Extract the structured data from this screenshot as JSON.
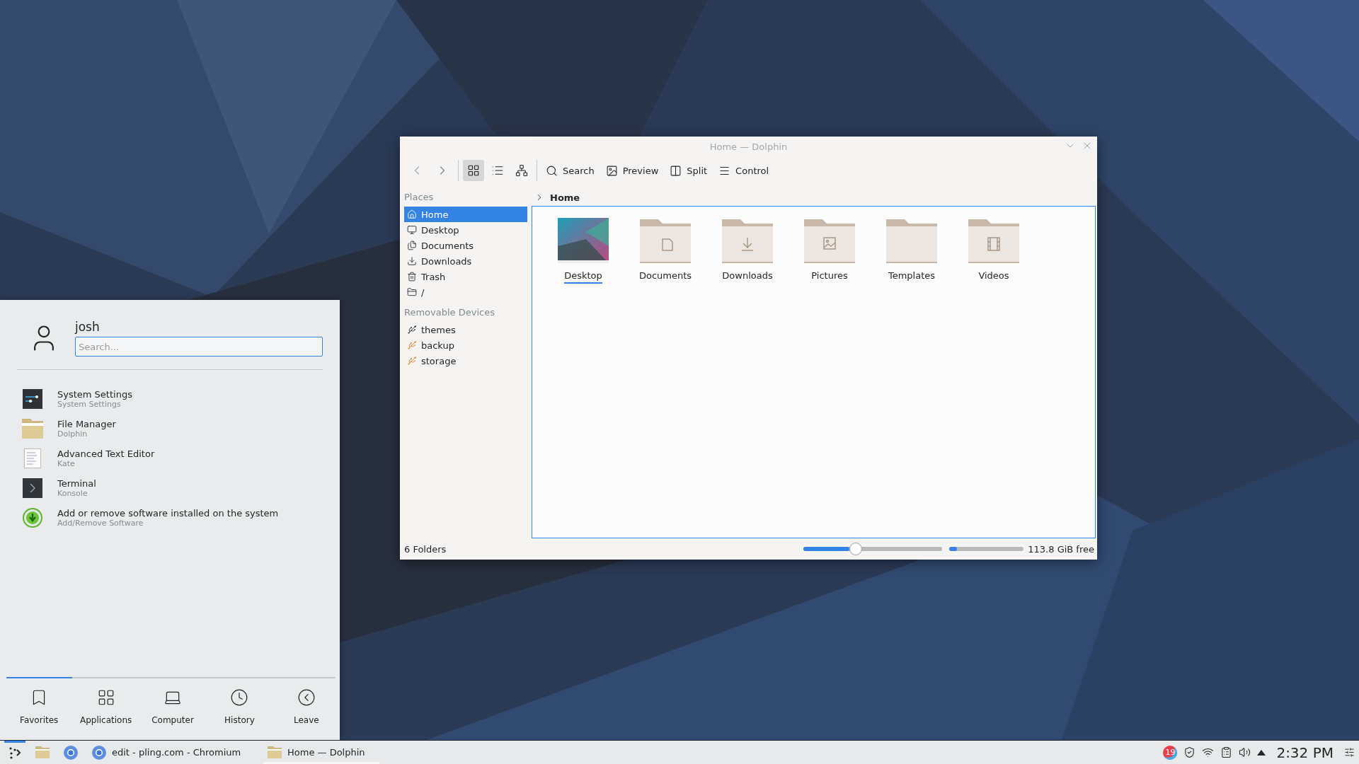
{
  "dolphin": {
    "title": "Home — Dolphin",
    "view_modes": [
      {
        "kind": "icons",
        "selected": true
      },
      {
        "kind": "compact",
        "selected": false
      },
      {
        "kind": "details",
        "selected": false
      }
    ],
    "actions": [
      {
        "kind": "search",
        "label": "Search"
      },
      {
        "kind": "preview",
        "label": "Preview"
      },
      {
        "kind": "split",
        "label": "Split"
      },
      {
        "kind": "menu",
        "label": "Control"
      }
    ],
    "places": [
      {
        "heading": "Places",
        "items": [
          {
            "kind": "home",
            "label": "Home",
            "selected": true
          },
          {
            "kind": "desktop",
            "label": "Desktop",
            "selected": false
          },
          {
            "kind": "documents",
            "label": "Documents",
            "selected": false
          },
          {
            "kind": "downloads",
            "label": "Downloads",
            "selected": false
          },
          {
            "kind": "trash",
            "label": "Trash",
            "selected": false
          },
          {
            "kind": "root",
            "label": "/",
            "selected": false
          }
        ]
      },
      {
        "heading": "Removable Devices",
        "items": [
          {
            "kind": "drive",
            "label": "themes",
            "selected": false
          },
          {
            "kind": "drive-warn",
            "label": "backup",
            "selected": false
          },
          {
            "kind": "drive-warn",
            "label": "storage",
            "selected": false
          }
        ]
      }
    ],
    "breadcrumb": "Home",
    "folders": [
      {
        "kind": "thumbnail",
        "label": "Desktop",
        "selected": true
      },
      {
        "kind": "documents",
        "label": "Documents",
        "selected": false
      },
      {
        "kind": "downloads",
        "label": "Downloads",
        "selected": false
      },
      {
        "kind": "pictures",
        "label": "Pictures",
        "selected": false
      },
      {
        "kind": "plain",
        "label": "Templates",
        "selected": false
      },
      {
        "kind": "videos",
        "label": "Videos",
        "selected": false
      }
    ],
    "status": {
      "count": "6 Folders",
      "zoom": {
        "level": 0.33
      },
      "disk": {
        "level": 0.1
      },
      "free": "113.8 GiB free"
    }
  },
  "start_menu": {
    "user": "josh",
    "search": {
      "placeholder": "Search..."
    },
    "entries": [
      {
        "kind": "settings",
        "name": "System Settings",
        "subtitle": "System Settings"
      },
      {
        "kind": "files",
        "name": "File Manager",
        "subtitle": "Dolphin"
      },
      {
        "kind": "editor",
        "name": "Advanced Text Editor",
        "subtitle": "Kate"
      },
      {
        "kind": "terminal",
        "name": "Terminal",
        "subtitle": "Konsole"
      },
      {
        "kind": "software",
        "name": "Add or remove software installed on the system",
        "subtitle": "Add/Remove Software"
      }
    ],
    "tabs": [
      {
        "kind": "favorites",
        "label": "Favorites",
        "selected": true
      },
      {
        "kind": "applications",
        "label": "Applications",
        "selected": false
      },
      {
        "kind": "computer",
        "label": "Computer",
        "selected": false
      },
      {
        "kind": "history",
        "label": "History",
        "selected": false
      },
      {
        "kind": "leave",
        "label": "Leave",
        "selected": false
      }
    ]
  },
  "taskbar": {
    "launcher": {
      "open": true
    },
    "pinned": [
      {
        "kind": "folder"
      },
      {
        "kind": "browser"
      }
    ],
    "tasks": [
      {
        "kind": "browser",
        "label": "edit - pling.com - Chromium",
        "active": false
      },
      {
        "kind": "folder",
        "label": "Home — Dolphin",
        "active": true
      }
    ],
    "notifications": "19",
    "clock": "2:32 PM"
  }
}
